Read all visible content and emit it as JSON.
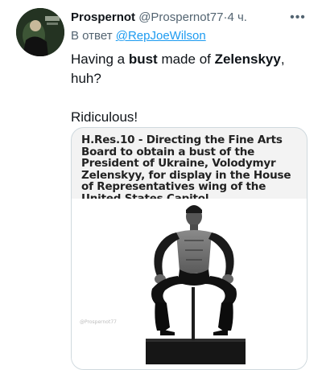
{
  "tweet": {
    "display_name": "Prospernot",
    "handle": "@Prospernot77",
    "separator": "·",
    "time": "4 ч.",
    "reply_prefix": "В ответ",
    "reply_to": "@RepJoeWilson",
    "text_line1_a": "Having a ",
    "text_line1_bold1": "bust",
    "text_line1_b": " made of ",
    "text_line1_bold2": "Zelenskyy",
    "text_line1_c": ", huh?",
    "text_line2": "Ridiculous!",
    "more_icon": "more-horizontal-icon"
  },
  "card": {
    "caption": "H.Res.10 - Directing the Fine Arts Board to obtain a bust of the President of Ukraine, Volodymyr Zelenskyy, for display in the House of Representatives wing of the United States Capitol.",
    "watermark": "@Prospernot77"
  }
}
